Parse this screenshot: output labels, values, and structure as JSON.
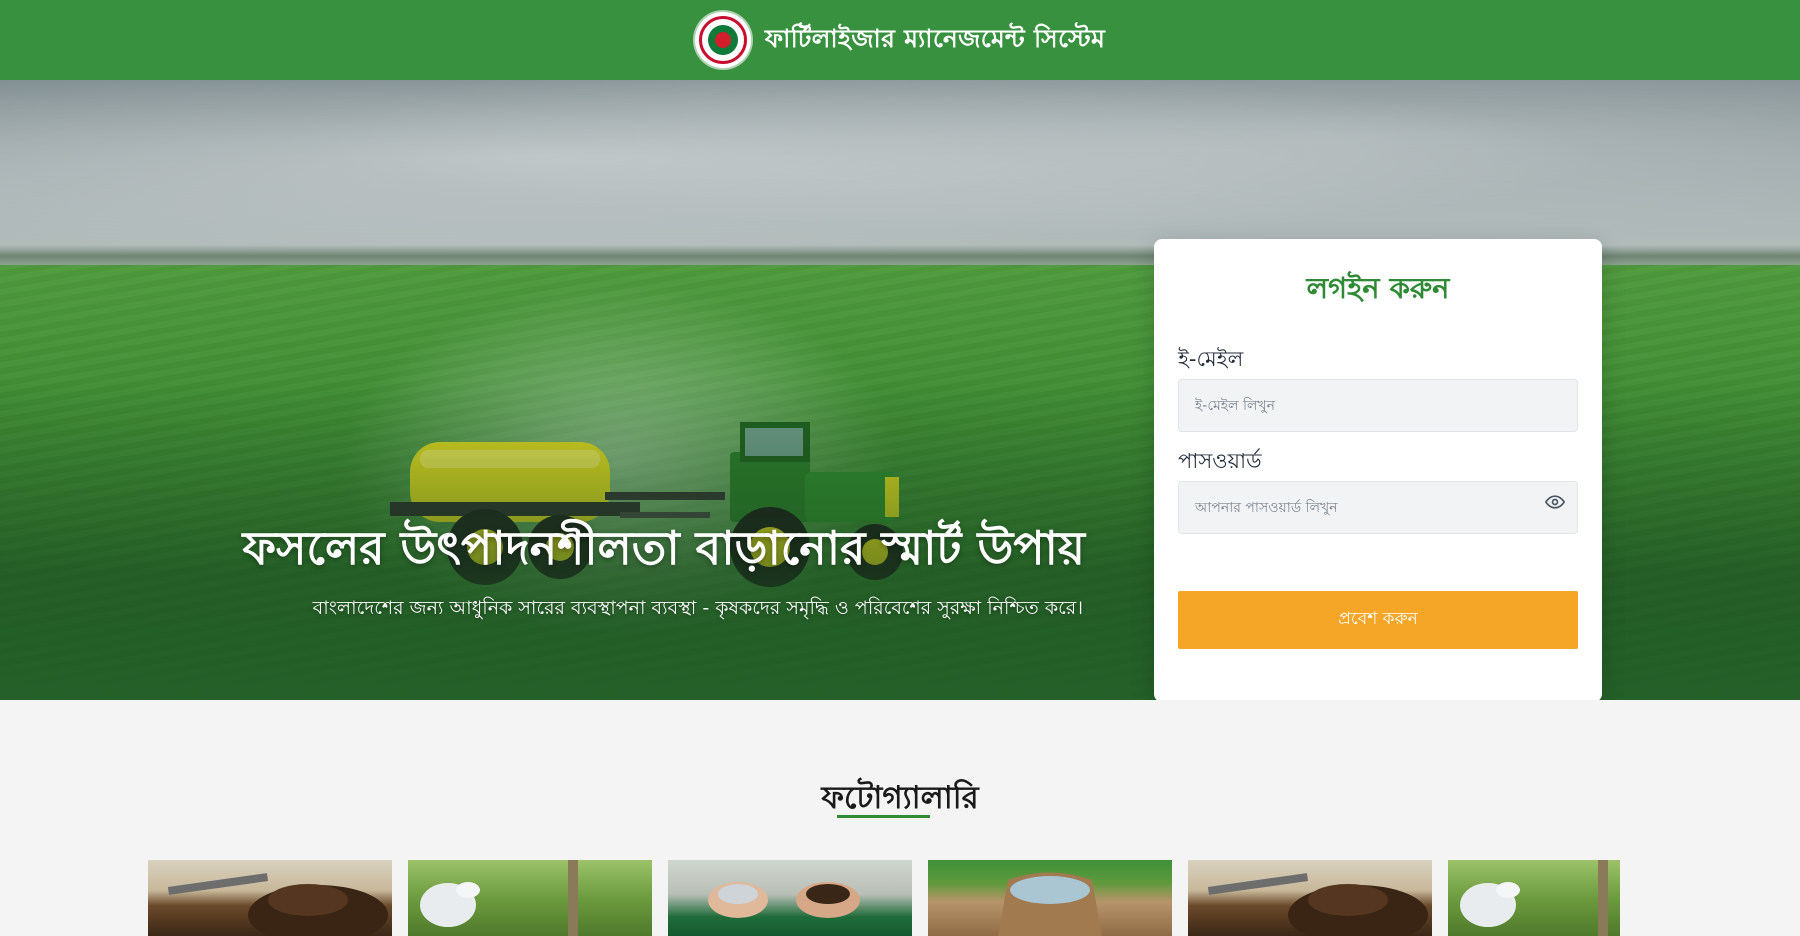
{
  "header": {
    "emblem_icon": "government-emblem-icon",
    "title": "ফার্টিলাইজার ম্যানেজমেন্ট সিস্টেম",
    "background": "#38913f"
  },
  "hero": {
    "headline": "ফসলের উৎপাদনশীলতা বাড়ানোর স্মার্ট উপায়",
    "subtitle": "বাংলাদেশের জন্য আধুনিক সারের ব্যবস্থাপনা ব্যবস্থা - কৃষকদের সমৃদ্ধি ও পরিবেশের সুরক্ষা নিশ্চিত করে।"
  },
  "login": {
    "title": "লগইন করুন",
    "email_label": "ই-মেইল",
    "email_placeholder": "ই-মেইল লিখুন",
    "email_value": "",
    "password_label": "পাসওয়ার্ড",
    "password_placeholder": "আপনার পাসওয়ার্ড লিখুন",
    "password_value": "",
    "toggle_icon": "eye-icon",
    "submit_label": "প্রবেশ করুন",
    "accent": "#2f8a35",
    "button_color": "#f6a626"
  },
  "gallery": {
    "title": "ফটোগ্যালারি",
    "images": [
      {
        "subject": "soil-shovel-image"
      },
      {
        "subject": "gloved-hand-planting-image"
      },
      {
        "subject": "hands-holding-fertilizer-image"
      },
      {
        "subject": "fertilizer-sack-image"
      },
      {
        "subject": "soil-shovel-image"
      },
      {
        "subject": "gloved-hand-planting-image"
      }
    ]
  }
}
